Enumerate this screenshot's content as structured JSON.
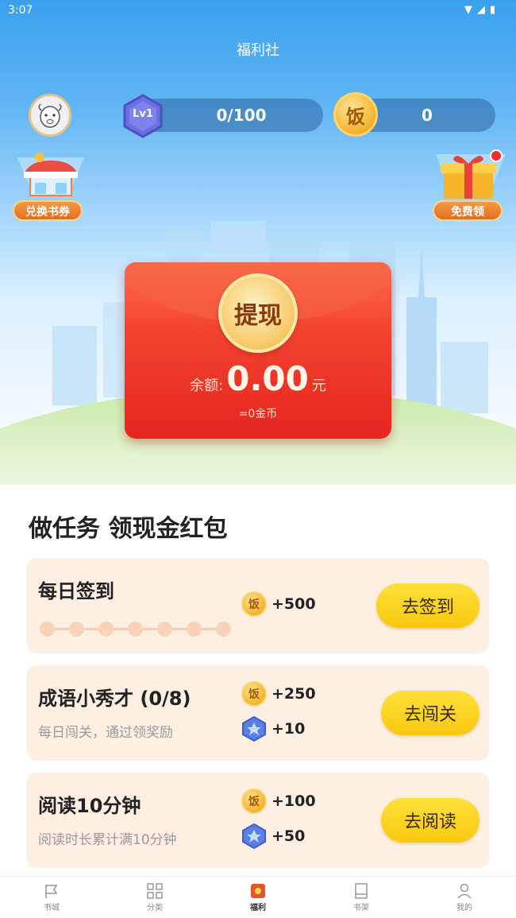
{
  "status_bar": {
    "time": "3:07"
  },
  "header": {
    "title": "福利社"
  },
  "user": {
    "level_badge": "Lv1",
    "level_progress": "0/100",
    "rice_coin_char": "饭",
    "rice_count": "0"
  },
  "shortcuts": {
    "exchange_label": "兑换书券",
    "free_label": "免费领"
  },
  "wallet": {
    "seal_label": "提现",
    "balance_label": "余额:",
    "balance_amount": "0.00",
    "balance_unit": "元",
    "coin_equivalent": "=0金币"
  },
  "tasks_section": {
    "title": "做任务 领现金红包"
  },
  "tasks": [
    {
      "name": "每日签到",
      "rewards": [
        {
          "icon": "rice-coin-icon",
          "coin_char": "饭",
          "amount": "+500"
        }
      ],
      "button": "去签到",
      "progress_days": 7
    },
    {
      "name": "成语小秀才 (0/8)",
      "desc": "每日闯关，通过领奖励",
      "rewards": [
        {
          "icon": "rice-coin-icon",
          "coin_char": "饭",
          "amount": "+250"
        },
        {
          "icon": "exp-gem-icon",
          "amount": "+10"
        }
      ],
      "button": "去闯关"
    },
    {
      "name": "阅读10分钟",
      "desc": "阅读时长累计满10分钟",
      "rewards": [
        {
          "icon": "rice-coin-icon",
          "coin_char": "饭",
          "amount": "+100"
        },
        {
          "icon": "exp-gem-icon",
          "amount": "+50"
        }
      ],
      "button": "去阅读"
    }
  ],
  "tab_bar": [
    {
      "label": "书城",
      "icon": "flag-icon",
      "active": false
    },
    {
      "label": "分类",
      "icon": "grid-icon",
      "active": false
    },
    {
      "label": "福利",
      "icon": "gift-box-icon",
      "active": true
    },
    {
      "label": "书架",
      "icon": "book-icon",
      "active": false
    },
    {
      "label": "我的",
      "icon": "person-icon",
      "active": false
    }
  ],
  "colors": {
    "sky_top": "#3aa0ee",
    "envelope_red": "#e5251f",
    "button_yellow": "#f9c80e",
    "card_bg": "#fdefe2"
  }
}
